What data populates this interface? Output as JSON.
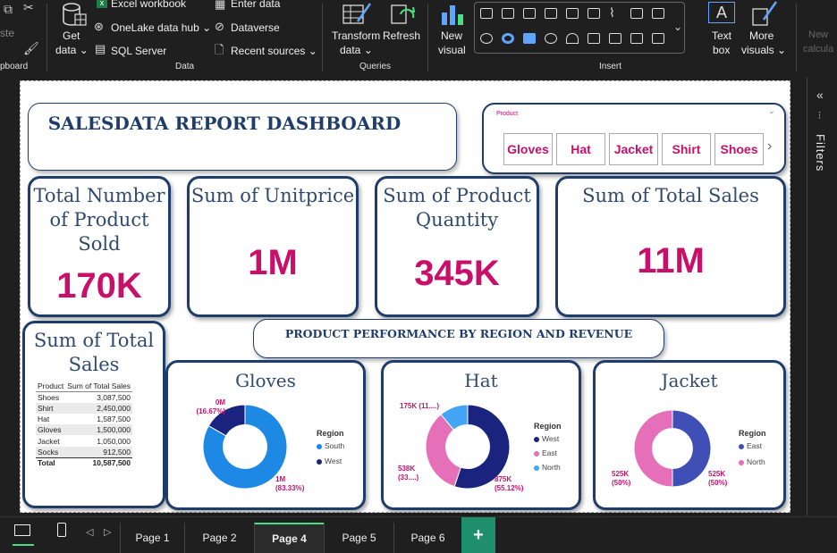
{
  "ribbon": {
    "clipboard_label": "pboard",
    "paste_label": "ste",
    "get_data": [
      "Get",
      "data"
    ],
    "excel": "Excel workbook",
    "onelake": "OneLake data hub",
    "sql": "SQL Server",
    "enter": "Enter data",
    "dataverse": "Dataverse",
    "recent": "Recent sources",
    "data_group": "Data",
    "transform": [
      "Transform",
      "data"
    ],
    "refresh": "Refresh",
    "queries_group": "Queries",
    "new_visual": [
      "New",
      "visual"
    ],
    "text_box": [
      "Text",
      "box"
    ],
    "more_visuals": [
      "More",
      "visuals"
    ],
    "insert_group": "Insert",
    "new_calc": [
      "New",
      "calcula"
    ]
  },
  "filters_pane": {
    "label": "Filters"
  },
  "report": {
    "title": "SALESDATA REPORT DASHBOARD",
    "slicer": {
      "label": "Product",
      "items": [
        "Gloves",
        "Hat",
        "Jacket",
        "Shirt",
        "Shoes"
      ]
    },
    "kpis": [
      {
        "label": "Total Number of Product Sold",
        "value": "170K"
      },
      {
        "label": "Sum of Unitprice",
        "value": "1M"
      },
      {
        "label": "Sum of Product Quantity",
        "value": "345K"
      },
      {
        "label": "Sum of Total Sales",
        "value": "11M"
      }
    ],
    "section_title": "PRODUCT PERFORMANCE BY REGION AND REVENUE",
    "table_card": {
      "title": "Sum of Total Sales",
      "headers": [
        "Product",
        "Sum of Total Sales"
      ],
      "rows": [
        [
          "Shoes",
          "3,087,500"
        ],
        [
          "Shirt",
          "2,450,000"
        ],
        [
          "Hat",
          "1,587,500"
        ],
        [
          "Gloves",
          "1,500,000"
        ],
        [
          "Jacket",
          "1,050,000"
        ],
        [
          "Socks",
          "912,500"
        ]
      ],
      "total": [
        "Total",
        "10,587,500"
      ]
    },
    "donuts": [
      {
        "title": "Gloves",
        "legend_title": "Region",
        "legend": [
          {
            "name": "South",
            "color": "#1e88e5"
          },
          {
            "name": "West",
            "color": "#1a237e"
          }
        ],
        "labels": [
          {
            "line1": "0M",
            "line2": "(16.67%)"
          },
          {
            "line1": "1M",
            "line2": "(83.33%)"
          }
        ]
      },
      {
        "title": "Hat",
        "legend_title": "Region",
        "legend": [
          {
            "name": "West",
            "color": "#1a237e"
          },
          {
            "name": "East",
            "color": "#e56fb8"
          },
          {
            "name": "North",
            "color": "#42a5f5"
          }
        ],
        "labels": [
          {
            "line1": "175K (11....)",
            "line2": ""
          },
          {
            "line1": "538K",
            "line2": "(33....)"
          },
          {
            "line1": "875K",
            "line2": "(55.12%)"
          }
        ]
      },
      {
        "title": "Jacket",
        "legend_title": "Region",
        "legend": [
          {
            "name": "East",
            "color": "#3f4fb5"
          },
          {
            "name": "North",
            "color": "#e56fb8"
          }
        ],
        "labels": [
          {
            "line1": "525K",
            "line2": "(50%)"
          },
          {
            "line1": "525K",
            "line2": "(50%)"
          }
        ]
      }
    ]
  },
  "chart_data": [
    {
      "type": "pie",
      "title": "Gloves",
      "categories": [
        "South",
        "West"
      ],
      "values": [
        83.33,
        16.67
      ],
      "value_labels": [
        "1M",
        "0M"
      ],
      "colors": [
        "#1e88e5",
        "#1a237e"
      ],
      "legend": "right"
    },
    {
      "type": "pie",
      "title": "Hat",
      "categories": [
        "West",
        "East",
        "North"
      ],
      "values": [
        55.12,
        33.86,
        11.02
      ],
      "value_labels": [
        "875K",
        "538K",
        "175K"
      ],
      "colors": [
        "#1a237e",
        "#e56fb8",
        "#42a5f5"
      ],
      "legend": "right"
    },
    {
      "type": "pie",
      "title": "Jacket",
      "categories": [
        "East",
        "North"
      ],
      "values": [
        50,
        50
      ],
      "value_labels": [
        "525K",
        "525K"
      ],
      "colors": [
        "#3f4fb5",
        "#e56fb8"
      ],
      "legend": "right"
    }
  ],
  "tabs": {
    "pages": [
      "Page 1",
      "Page 2",
      "Page 4",
      "Page 5",
      "Page 6"
    ],
    "active": "Page 4",
    "add": "+"
  }
}
